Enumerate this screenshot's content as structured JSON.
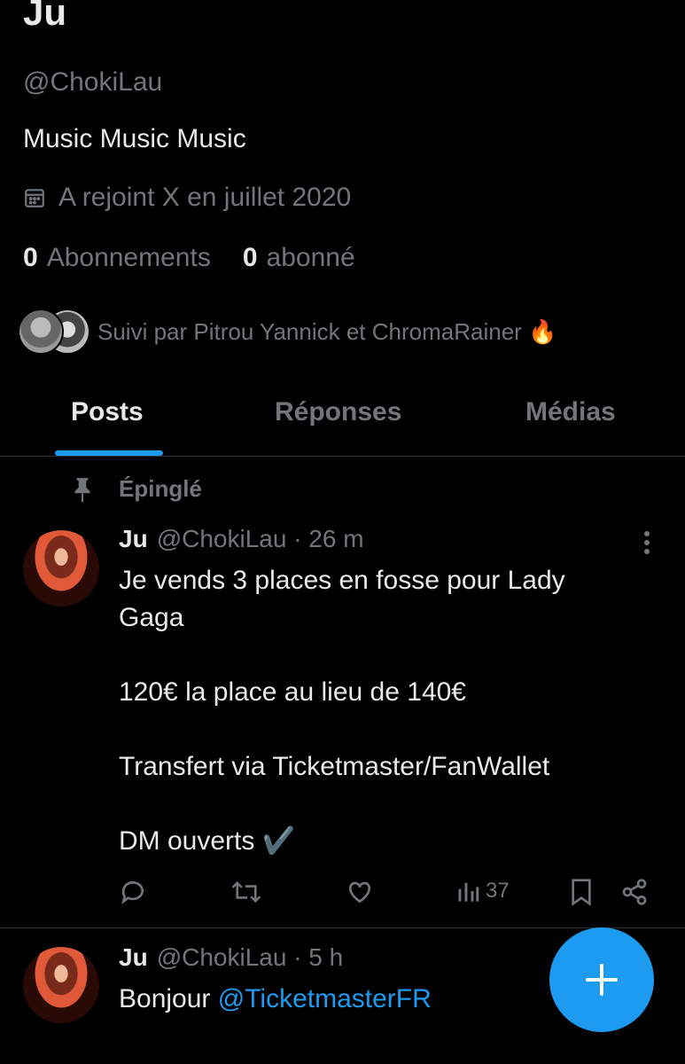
{
  "profile": {
    "name": "Ju",
    "handle": "@ChokiLau",
    "bio": "Music Music Music",
    "joined": "A rejoint X en juillet 2020",
    "following_count": "0",
    "following_label": "Abonnements",
    "followers_count": "0",
    "followers_label": "abonné",
    "followed_by": "Suivi par Pitrou Yannick et ChromaRainer 🔥"
  },
  "tabs": [
    {
      "label": "Posts",
      "active": true
    },
    {
      "label": "Réponses",
      "active": false
    },
    {
      "label": "Médias",
      "active": false
    }
  ],
  "pinned_label": "Épinglé",
  "tweets": [
    {
      "name": "Ju",
      "handle": "@ChokiLau · 26 m",
      "body": "Je vends 3 places en fosse pour Lady\nGaga\n\n120€ la place au lieu de 140€\n\nTransfert via Ticketmaster/FanWallet\n\nDM ouverts ✔️",
      "views": "37"
    },
    {
      "name": "Ju",
      "handle": "@ChokiLau · 5 h",
      "body_prefix": "Bonjour ",
      "mention": "@TicketmasterFR"
    }
  ],
  "colors": {
    "accent": "#1d9bf0",
    "muted": "#71767b",
    "text": "#e7e9ea",
    "bg": "#000000"
  }
}
